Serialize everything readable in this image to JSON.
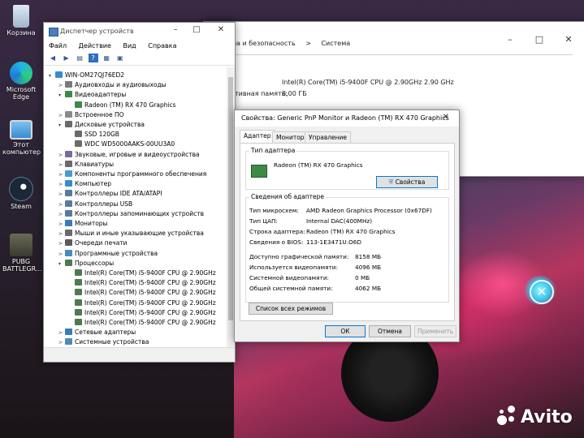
{
  "desktop_icons": [
    {
      "label": "Корзина",
      "icon": "recycle-bin-icon"
    },
    {
      "label": "Microsoft Edge",
      "icon": "edge-icon"
    },
    {
      "label": "Этот компьютер",
      "icon": "computer-icon"
    },
    {
      "label": "Steam",
      "icon": "steam-icon"
    },
    {
      "label": "PUBG BATTLEGR...",
      "icon": "pubg-icon"
    }
  ],
  "settings_window": {
    "breadcrumb": [
      "ма и безопасность",
      ">",
      "Система"
    ],
    "cpu_line": "Intel(R) Core(TM) i5-9400F CPU @ 2.90GHz   2.90 GHz",
    "ram_label": "тивная память:",
    "ram_value": "8,00 ГБ"
  },
  "device_manager": {
    "title": "Диспетчер устройств",
    "menu": [
      "Файл",
      "Действие",
      "Вид",
      "Справка"
    ],
    "tree": [
      {
        "level": 0,
        "exp": "▾",
        "label": "WIN-OM27QJ76ED2",
        "icon": "computer-icon"
      },
      {
        "level": 1,
        "exp": ">",
        "label": "Аудиовходы и аудиовыходы",
        "icon": "audio-icon"
      },
      {
        "level": 1,
        "exp": "▾",
        "label": "Видеоадаптеры",
        "icon": "display-adapter-icon"
      },
      {
        "level": 2,
        "exp": "",
        "label": "Radeon (TM) RX 470 Graphics",
        "icon": "display-adapter-icon"
      },
      {
        "level": 1,
        "exp": ">",
        "label": "Встроенное ПО",
        "icon": "firmware-icon"
      },
      {
        "level": 1,
        "exp": "▾",
        "label": "Дисковые устройства",
        "icon": "disk-icon"
      },
      {
        "level": 2,
        "exp": "",
        "label": "SSD 120GB",
        "icon": "disk-icon"
      },
      {
        "level": 2,
        "exp": "",
        "label": "WDC WD5000AAKS-00UU3A0",
        "icon": "disk-icon"
      },
      {
        "level": 1,
        "exp": ">",
        "label": "Звуковые, игровые и видеоустройства",
        "icon": "sound-icon"
      },
      {
        "level": 1,
        "exp": ">",
        "label": "Клавиатуры",
        "icon": "keyboard-icon"
      },
      {
        "level": 1,
        "exp": ">",
        "label": "Компоненты программного обеспечения",
        "icon": "software-icon"
      },
      {
        "level": 1,
        "exp": ">",
        "label": "Компьютер",
        "icon": "computer-icon"
      },
      {
        "level": 1,
        "exp": ">",
        "label": "Контроллеры IDE ATA/ATAPI",
        "icon": "ide-icon"
      },
      {
        "level": 1,
        "exp": ">",
        "label": "Контроллеры USB",
        "icon": "usb-icon"
      },
      {
        "level": 1,
        "exp": ">",
        "label": "Контроллеры запоминающих устройств",
        "icon": "storage-controller-icon"
      },
      {
        "level": 1,
        "exp": ">",
        "label": "Мониторы",
        "icon": "monitor-icon"
      },
      {
        "level": 1,
        "exp": ">",
        "label": "Мыши и иные указывающие устройства",
        "icon": "mouse-icon"
      },
      {
        "level": 1,
        "exp": ">",
        "label": "Очереди печати",
        "icon": "printer-icon"
      },
      {
        "level": 1,
        "exp": ">",
        "label": "Программные устройства",
        "icon": "software-device-icon"
      },
      {
        "level": 1,
        "exp": "▾",
        "label": "Процессоры",
        "icon": "cpu-icon"
      },
      {
        "level": 2,
        "exp": "",
        "label": "Intel(R) Core(TM) i5-9400F CPU @ 2.90GHz",
        "icon": "cpu-icon"
      },
      {
        "level": 2,
        "exp": "",
        "label": "Intel(R) Core(TM) i5-9400F CPU @ 2.90GHz",
        "icon": "cpu-icon"
      },
      {
        "level": 2,
        "exp": "",
        "label": "Intel(R) Core(TM) i5-9400F CPU @ 2.90GHz",
        "icon": "cpu-icon"
      },
      {
        "level": 2,
        "exp": "",
        "label": "Intel(R) Core(TM) i5-9400F CPU @ 2.90GHz",
        "icon": "cpu-icon"
      },
      {
        "level": 2,
        "exp": "",
        "label": "Intel(R) Core(TM) i5-9400F CPU @ 2.90GHz",
        "icon": "cpu-icon"
      },
      {
        "level": 2,
        "exp": "",
        "label": "Intel(R) Core(TM) i5-9400F CPU @ 2.90GHz",
        "icon": "cpu-icon"
      },
      {
        "level": 1,
        "exp": ">",
        "label": "Сетевые адаптеры",
        "icon": "network-icon"
      },
      {
        "level": 1,
        "exp": ">",
        "label": "Системные устройства",
        "icon": "system-device-icon"
      }
    ]
  },
  "properties_dialog": {
    "title": "Свойства: Generic PnP Monitor и Radeon (TM) RX 470 Graphics",
    "tabs": [
      "Адаптер",
      "Монитор",
      "Управление цветом"
    ],
    "adapter_type_legend": "Тип адаптера",
    "adapter_name": "Radeon (TM) RX 470 Graphics",
    "properties_button": "Свойства",
    "adapter_info_legend": "Сведения об адаптере",
    "info": [
      {
        "label": "Тип микросхем:",
        "value": "AMD Radeon Graphics Processor (0x67DF)"
      },
      {
        "label": "Тип ЦАП:",
        "value": "Internal DAC(400MHz)"
      },
      {
        "label": "Строка адаптера:",
        "value": "Radeon (TM) RX 470 Graphics"
      },
      {
        "label": "Сведения о BIOS:",
        "value": "113-1E3471U.O6D"
      }
    ],
    "memory": [
      {
        "label": "Доступно графической памяти:",
        "value": "8158 МБ"
      },
      {
        "label": "Используется видеопамяти:",
        "value": "4096 МБ"
      },
      {
        "label": "Системной видеопамяти:",
        "value": "0 МБ"
      },
      {
        "label": "Общей системной памяти:",
        "value": "4062 МБ"
      }
    ],
    "list_modes_button": "Список всех режимов",
    "ok_button": "ОК",
    "cancel_button": "Отмена",
    "apply_button": "Применить"
  },
  "watermark": "Avito"
}
